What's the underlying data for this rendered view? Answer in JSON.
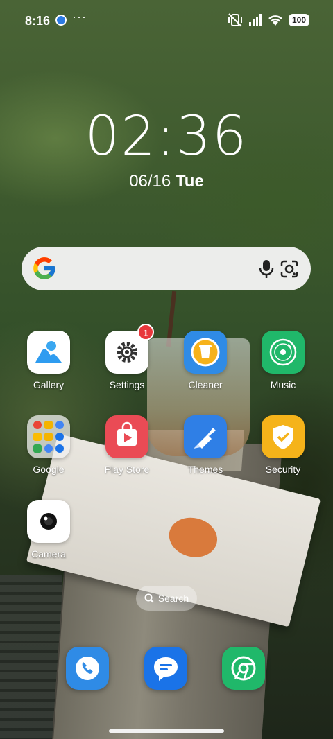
{
  "status_bar": {
    "time": "8:16",
    "overflow": "···",
    "battery": "100",
    "icons": [
      "app-notification-icon",
      "vibrate-off-icon",
      "signal-icon",
      "wifi-icon",
      "battery-icon"
    ]
  },
  "clock": {
    "time": "02:36",
    "date": "06/16",
    "weekday": "Tue"
  },
  "google_search": {
    "icons": [
      "google-logo-icon",
      "microphone-icon",
      "google-lens-icon"
    ]
  },
  "apps": [
    {
      "label": "Gallery",
      "icon": "gallery-icon"
    },
    {
      "label": "Settings",
      "icon": "settings-gear-icon",
      "badge": "1"
    },
    {
      "label": "Cleaner",
      "icon": "cleaner-trash-icon"
    },
    {
      "label": "Music",
      "icon": "music-disc-icon"
    },
    {
      "label": "Google",
      "icon": "google-folder-icon"
    },
    {
      "label": "Play Store",
      "icon": "play-store-icon"
    },
    {
      "label": "Themes",
      "icon": "themes-brush-icon"
    },
    {
      "label": "Security",
      "icon": "security-shield-icon"
    },
    {
      "label": "Camera",
      "icon": "camera-icon"
    }
  ],
  "home_search": {
    "label": "Search"
  },
  "dock": [
    {
      "name": "phone",
      "icon": "phone-icon"
    },
    {
      "name": "messages",
      "icon": "messages-icon"
    },
    {
      "name": "chrome",
      "icon": "chrome-icon"
    }
  ],
  "colors": {
    "settings_badge": "#e8373c",
    "cleaner": "#2f8be6",
    "music": "#20b86a",
    "play_store": "#ea4b55",
    "themes": "#2f7fe6",
    "security": "#f5b31a"
  }
}
